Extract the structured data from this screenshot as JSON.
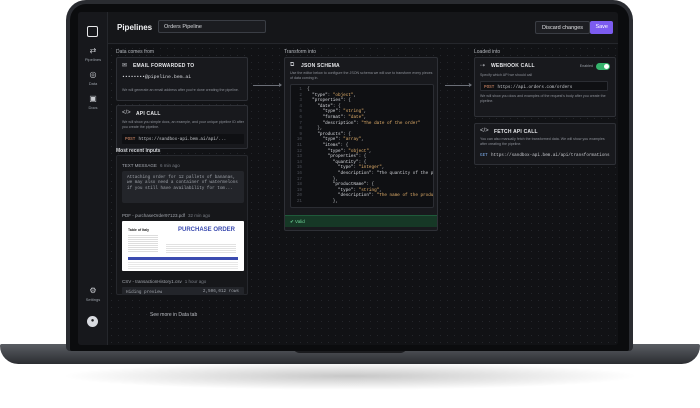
{
  "sidebar": {
    "items": [
      {
        "label": "Pipelines",
        "icon": "pipelines-icon"
      },
      {
        "label": "Data",
        "icon": "data-icon"
      },
      {
        "label": "Docs",
        "icon": "docs-icon"
      }
    ],
    "settings_label": "Settings"
  },
  "header": {
    "title": "Pipelines",
    "pipeline_name": "Orders Pipeline",
    "discard_label": "Discard changes",
    "save_label": "Save"
  },
  "columns": {
    "source": "Data comes from",
    "transform": "Transform into",
    "destination": "Loaded into"
  },
  "email_card": {
    "title": "EMAIL FORWARDED TO",
    "address": "••••••••@pipeline.bem.ai",
    "note": "We will generate an email address after you're done creating the pipeline."
  },
  "api_card": {
    "title": "API CALL",
    "note": "We will show you simple docs, an example, and your unique pipeline ID after you create the pipeline.",
    "method": "POST",
    "url": "https://sandbox-api.bem.ai/api/..."
  },
  "schema_card": {
    "title": "JSON SCHEMA",
    "note": "Use the editor below to configure the JSON schema we will use to transform every pieces of data coming in.",
    "lines": [
      {
        "n": "1",
        "t": "{"
      },
      {
        "n": "2",
        "t": "  \"type\": \"object\","
      },
      {
        "n": "3",
        "t": "  \"properties\": {"
      },
      {
        "n": "4",
        "t": "    \"date\": {"
      },
      {
        "n": "5",
        "t": "      \"type\": \"string\","
      },
      {
        "n": "6",
        "t": "      \"format\": \"date\","
      },
      {
        "n": "7",
        "t": "      \"description\": \"The date of the order\""
      },
      {
        "n": "8",
        "t": "    },"
      },
      {
        "n": "9",
        "t": "    \"products\": {"
      },
      {
        "n": "10",
        "t": "      \"type\": \"array\","
      },
      {
        "n": "11",
        "t": "      \"items\": {"
      },
      {
        "n": "12",
        "t": "        \"type\": \"object\","
      },
      {
        "n": "13",
        "t": "        \"properties\": {"
      },
      {
        "n": "14",
        "t": "          \"quantity\": {"
      },
      {
        "n": "15",
        "t": "            \"type\": \"integer\","
      },
      {
        "n": "16",
        "t": "            \"description\": \"The quantity of the prod"
      },
      {
        "n": "17",
        "t": "          },"
      },
      {
        "n": "18",
        "t": "          \"productName\": {"
      },
      {
        "n": "19",
        "t": "            \"type\": \"string\","
      },
      {
        "n": "20",
        "t": "            \"description\": \"The name of the product\""
      },
      {
        "n": "21",
        "t": "          },"
      }
    ],
    "valid_label": "Valid"
  },
  "webhook_card": {
    "title": "WEBHOOK CALL",
    "note": "Specify which API we should call",
    "toggle_label": "Enabled",
    "method": "POST",
    "url": "https://api.orders.com/orders",
    "footer_note": "We will show you docs and examples of the request's body after you create the pipeline."
  },
  "fetch_card": {
    "title": "FETCH API CALL",
    "note": "You can also manually fetch the transformed data. We will show you examples after creating the pipeline.",
    "method": "GET",
    "url": "https://sandbox-api.bem.ai/api/transformations"
  },
  "recent": {
    "title": "Most recent inputs",
    "text_label": "TEXT MESSAGE",
    "text_ago": "6 min ago",
    "text_body": "Attaching order for 12 pallets of bananas, we may also need a container of watermelons if you still have availability for tom...",
    "pdf_label": "PDF - purchaseOrder97123.pdf",
    "pdf_ago": "32 min ago",
    "pdf_heading": "PURCHASE ORDER",
    "pdf_company": "Table of Italy",
    "csv_label": "CSV - transactionHistory1.csv",
    "csv_ago": "1 hour ago",
    "csv_preview_label": "Hiding preview",
    "csv_rows": "2,506,012 rows",
    "see_more": "See more in Data tab"
  }
}
